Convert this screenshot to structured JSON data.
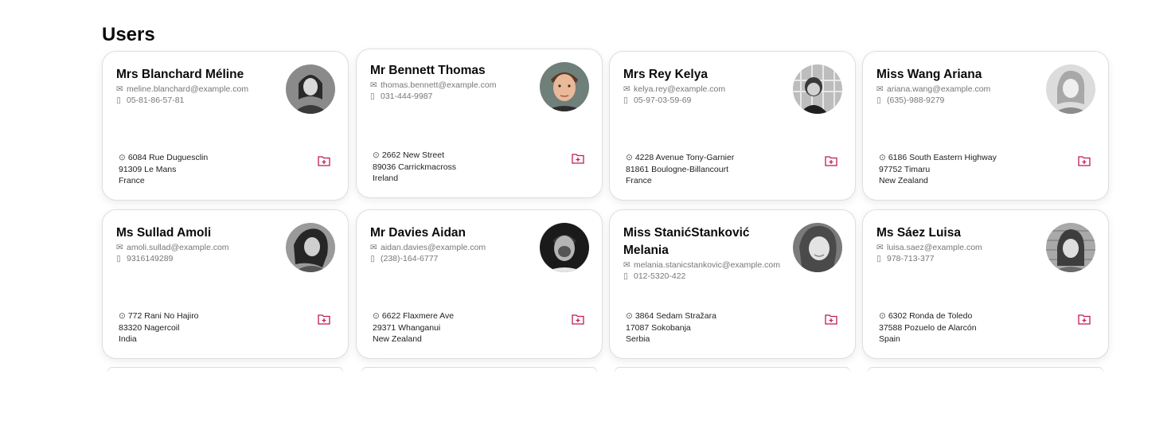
{
  "page": {
    "title": "Users"
  },
  "colors": {
    "accent": "#c2185b",
    "border": "#dedede",
    "muted_text": "#777777"
  },
  "icons": {
    "email": "mail-icon",
    "phone": "phone-icon",
    "address": "location-pin-icon",
    "action": "folder-plus-icon"
  },
  "users": [
    {
      "name": "Mrs Blanchard Méline",
      "email": "meline.blanchard@example.com",
      "phone": "05-81-86-57-81",
      "street": "6084 Rue Duguesclin",
      "city": "91309 Le Mans",
      "country": "France"
    },
    {
      "name": "Mr Bennett Thomas",
      "email": "thomas.bennett@example.com",
      "phone": "031-444-9987",
      "street": "2662 New Street",
      "city": "89036 Carrickmacross",
      "country": "Ireland"
    },
    {
      "name": "Mrs Rey Kelya",
      "email": "kelya.rey@example.com",
      "phone": "05-97-03-59-69",
      "street": "4228 Avenue Tony-Garnier",
      "city": "81861 Boulogne-Billancourt",
      "country": "France"
    },
    {
      "name": "Miss Wang Ariana",
      "email": "ariana.wang@example.com",
      "phone": "(635)-988-9279",
      "street": "6186 South Eastern Highway",
      "city": "97752 Timaru",
      "country": "New Zealand"
    },
    {
      "name": "Ms Sullad Amoli",
      "email": "amoli.sullad@example.com",
      "phone": "9316149289",
      "street": "772 Rani No Hajiro",
      "city": "83320 Nagercoil",
      "country": "India"
    },
    {
      "name": "Mr Davies Aidan",
      "email": "aidan.davies@example.com",
      "phone": "(238)-164-6777",
      "street": "6622 Flaxmere Ave",
      "city": "29371 Whanganui",
      "country": "New Zealand"
    },
    {
      "name": "Miss StanićStanković Melania",
      "email": "melania.stanicstankovic@example.com",
      "phone": "012-5320-422",
      "street": "3864 Sedam Stražara",
      "city": "17087 Sokobanja",
      "country": "Serbia"
    },
    {
      "name": "Ms Sáez Luisa",
      "email": "luisa.saez@example.com",
      "phone": "978-713-377",
      "street": "6302 Ronda de Toledo",
      "city": "37588 Pozuelo de Alarcón",
      "country": "Spain"
    }
  ]
}
